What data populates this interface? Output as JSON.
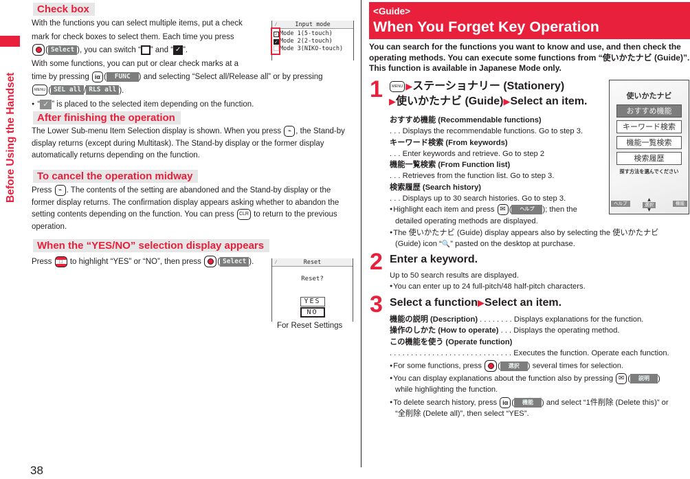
{
  "side_label": "Before Using the Handset",
  "page_number": "38",
  "accent_color": "#e8203c",
  "left": {
    "checkbox": {
      "heading": "Check box",
      "p1_a": "With the functions you can select multiple items, put a check",
      "p1_b": "mark for check boxes to select them. Each time you press",
      "p1_c1": "(",
      "p1_c2": "), you can switch “",
      "p1_c3": "” and “",
      "p1_c4": "”.",
      "p2_a": "With some functions, you can put or clear check marks at a",
      "p2_b1": "time by pressing",
      "p2_b2": ") and selecting “Select all/Release all” or by pressing",
      "p2_c_sep": "/",
      "p2_c_end": ").",
      "bullet_a": " “",
      "bullet_b": "” is placed to the selected item depending on the function.",
      "softkeys": {
        "select": "Select",
        "func": "FUNC",
        "sel_all": "SEL all",
        "rls_all": "RLS all"
      },
      "keys": {
        "menu": "MENU",
        "i_alpha": "iα"
      },
      "screen": {
        "title": "Input mode",
        "rows": [
          "Mode 1(5-touch)",
          "Mode 2(2-touch)",
          "Mode 3(NIKO-touch)"
        ]
      }
    },
    "after": {
      "heading": "After finishing the operation",
      "text_a": "The Lower Sub-menu Item Selection display is shown. When you press",
      "text_b": ", the Stand-by display returns (except during Multitask). The Stand-by display or the former display automatically returns depending on the function."
    },
    "cancel": {
      "heading": "To cancel the operation midway",
      "text_a": "Press",
      "text_b": ". The contents of the setting are abandoned and the Stand-by display or the former display returns. The confirmation display appears asking whether to abandon the setting contents depending on the function. You can press",
      "clr": "CLR",
      "text_c": "to return to the previous operation."
    },
    "yesno": {
      "heading": "When the “YES/NO” selection display appears",
      "text_a": "Press",
      "text_b": "to highlight “YES” or “NO”, then press",
      "text_c": ").",
      "screen": {
        "title": "Reset",
        "question": "Reset?",
        "yes": "YES",
        "no": "NO"
      },
      "caption": "For Reset Settings"
    }
  },
  "right": {
    "banner_tag": "<Guide>",
    "banner_title": "When You Forget Key Operation",
    "intro": "You can search for the functions you want to know and use, and then check the operating methods. You can execute some functions from “使いかたナビ (Guide)”. This function is available in Japanese Mode only.",
    "step1": {
      "num": "1",
      "line1": "ステーショナリー (Stationery)",
      "line2a": "使いかたナビ (Guide)",
      "line2b": "Select an item.",
      "items": [
        {
          "label": "おすすめ機能 (Recommendable functions)",
          "desc": ". . .  Displays the recommendable functions. Go to step 3."
        },
        {
          "label": "キーワード検索 (From keywords)",
          "desc": ". . .  Enter keywords and retrieve. Go to step 2"
        },
        {
          "label": "機能一覧検索 (From Function list)",
          "desc": ". . .  Retrieves from the function list. Go to step 3."
        },
        {
          "label": "検索履歴 (Search history)",
          "desc": ". . .  Displays up to 30 search histories. Go to step 3."
        }
      ],
      "bullet1_a": "Highlight each item and press",
      "bullet1_b": "); then the",
      "bullet1_c": "detailed operating methods are displayed.",
      "bullet2_a": "The 使いかたナビ (Guide) display appears also by selecting the 使いかたナビ",
      "bullet2_b": "(Guide) icon “",
      "bullet2_c": "” pasted on the desktop at purchase.",
      "softkey_help": "ヘルプ",
      "screen": {
        "title": "使いかたナビ",
        "items": [
          "おすすめ機能",
          "キーワード検索",
          "機能一覧検索",
          "検索履歴"
        ],
        "hint": "探す方法を選んでください",
        "soft_left": "ヘルプ",
        "soft_center": "選択",
        "soft_right": "機能"
      }
    },
    "step2": {
      "num": "2",
      "title": "Enter a keyword.",
      "text": "Up to 50 search results are displayed.",
      "bullet": "You can enter up to 24 full-pitch/48 half-pitch characters."
    },
    "step3": {
      "num": "3",
      "title_a": "Select a function",
      "title_b": "Select an item.",
      "item1_label": "機能の説明 (Description)",
      "item1_desc": " . . . . . . . . Displays explanations for the function.",
      "item2_label": "操作のしかた (How to operate)",
      "item2_desc": " . . . Displays the operating method.",
      "item3_label": "この機能を使う (Operate function)",
      "item3_desc": ". . . . . . . . . . . . . . . . . . . . . . . . . . . . . Executes the function. Operate each function.",
      "bullet1_a": "For some functions, press",
      "bullet1_b": ") several times for selection.",
      "bullet2_a": "You can display explanations about the function also by pressing",
      "bullet2_b": ")",
      "bullet2_c": "while highlighting the function.",
      "bullet3_a": "To delete search history, press",
      "bullet3_b": ") and select “1件削除 (Delete this)” or",
      "bullet3_c": "“全削除 (Delete all)”, then select “YES”.",
      "softkeys": {
        "select": "選択",
        "explain": "説明",
        "func": "機能"
      }
    }
  }
}
